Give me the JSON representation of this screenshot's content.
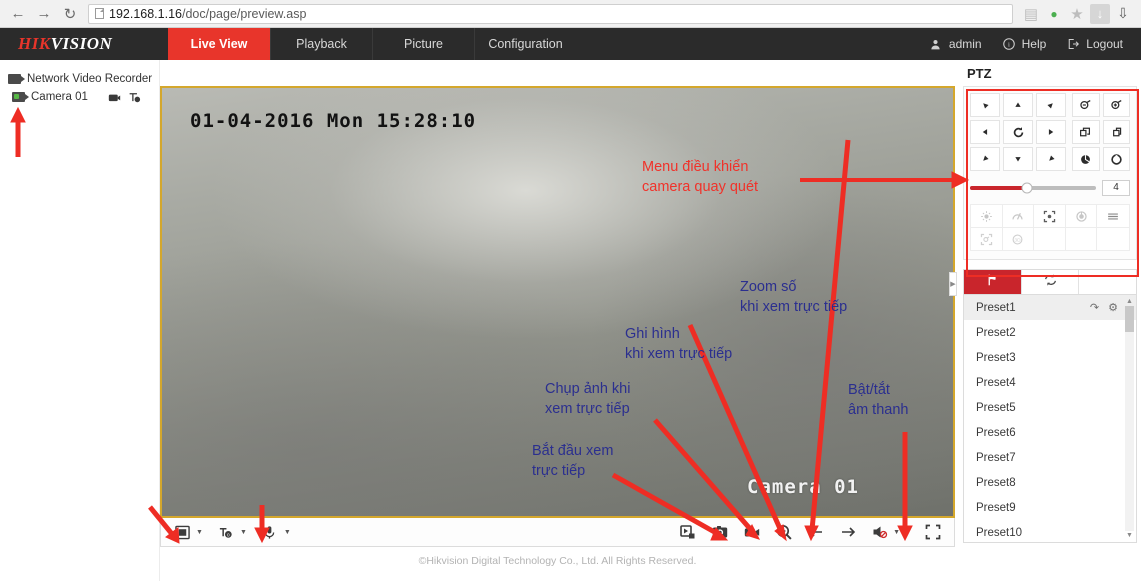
{
  "browser": {
    "back_icon": "back-arrow-icon",
    "forward_icon": "forward-arrow-icon",
    "reload_icon": "reload-icon",
    "url_host": "192.168.1.16",
    "url_path": "/doc/page/preview.asp",
    "url_full": "192.168.1.16/doc/page/preview.asp",
    "icons": [
      "extension-icon",
      "adblock-icon",
      "bookmark-star-icon",
      "download-arrow-icon",
      "downloads-tray-icon"
    ]
  },
  "header": {
    "logo_hik": "HIK",
    "logo_vision": "VISION",
    "tabs": [
      {
        "label": "Live View",
        "active": true
      },
      {
        "label": "Playback",
        "active": false
      },
      {
        "label": "Picture",
        "active": false
      },
      {
        "label": "Configuration",
        "active": false
      }
    ],
    "user": "admin",
    "help": "Help",
    "logout": "Logout"
  },
  "sidebar": {
    "root": "Network Video Recorder",
    "camera": "Camera 01"
  },
  "video": {
    "osd_time": "01-04-2016 Mon 15:28:10",
    "osd_date": "01-04-2016",
    "osd_day": "Mon",
    "osd_clock": "15:28:10",
    "osd_name": "Camera 01"
  },
  "toolbar": {
    "left": [
      {
        "name": "window-division-button",
        "glyph": "▣"
      },
      {
        "name": "stream-type-button",
        "glyph": "t"
      },
      {
        "name": "microphone-button",
        "glyph": "mic"
      }
    ],
    "right": [
      {
        "name": "start-live-view-button",
        "glyph": "play-stop"
      },
      {
        "name": "capture-snapshot-button",
        "glyph": "camera"
      },
      {
        "name": "record-button",
        "glyph": "camcorder"
      },
      {
        "name": "digital-zoom-button",
        "glyph": "magnifier"
      },
      {
        "name": "previous-button",
        "glyph": "←"
      },
      {
        "name": "next-button",
        "glyph": "→"
      },
      {
        "name": "audio-toggle-button",
        "glyph": "speaker"
      },
      {
        "name": "fullscreen-button",
        "glyph": "expand"
      }
    ]
  },
  "copyright": "©Hikvision Digital Technology Co., Ltd. All Rights Reserved.",
  "ptz": {
    "title": "PTZ",
    "dpad": [
      "up-left-arrow",
      "up-arrow",
      "up-right-arrow",
      "left-arrow",
      "auto-scan",
      "right-arrow",
      "down-left-arrow",
      "down-arrow",
      "down-right-arrow"
    ],
    "lens": [
      "zoom-out-button",
      "zoom-in-button",
      "focus-near-button",
      "focus-far-button",
      "iris-close-button",
      "iris-open-button"
    ],
    "speed_value": "4",
    "speed_percent": 45,
    "functions_row1": [
      "light-button",
      "wiper-button",
      "auto-focus-button",
      "lens-initialization-button",
      "menu-button"
    ],
    "functions_row2": [
      "one-touch-focus-button",
      "manual-tracking-button",
      "",
      "",
      ""
    ]
  },
  "presets": {
    "tabs": [
      {
        "name": "preset-tab",
        "icon": "flag-icon",
        "active": true
      },
      {
        "name": "patrol-tab",
        "icon": "refresh-icon",
        "active": false
      },
      {
        "name": "pattern-tab",
        "icon": "blank-icon",
        "active": false
      }
    ],
    "items": [
      "Preset1",
      "Preset2",
      "Preset3",
      "Preset4",
      "Preset5",
      "Preset6",
      "Preset7",
      "Preset8",
      "Preset9",
      "Preset10"
    ],
    "selected_index": 0,
    "row_actions": [
      "call-preset-icon",
      "set-preset-icon"
    ]
  },
  "annotations": {
    "ptz_menu": "Menu điều khiển\ncamera quay quét",
    "digital_zoom": "Zoom số\nkhi xem trực tiếp",
    "record": "Ghi hình\nkhi xem trực tiếp",
    "snapshot": "Chụp ảnh khi\nxem trực tiếp",
    "start_live": "Bắt đầu xem\ntrực tiếp",
    "audio": "Bật/tắt\nâm thanh"
  },
  "colors": {
    "brand_red": "#e8352b",
    "annotation_blue": "#2b2f8f",
    "annotation_red": "#f0322a",
    "header_dark": "#2b2b2b",
    "video_border": "#d4a72c"
  }
}
